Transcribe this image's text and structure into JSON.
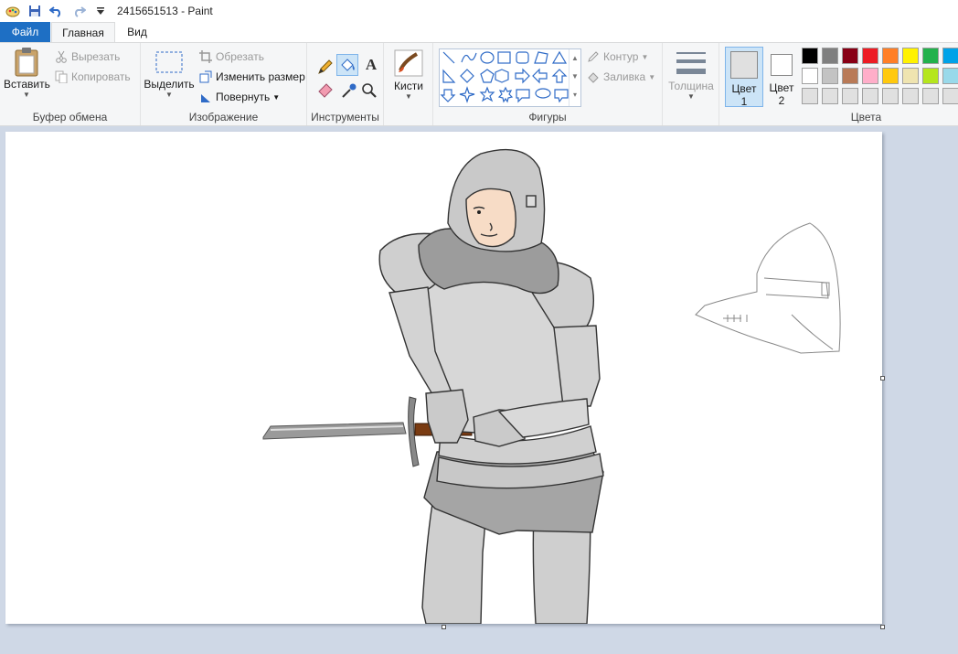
{
  "window": {
    "title": "2415651513 - Paint"
  },
  "tabs": [
    {
      "label": "Файл"
    },
    {
      "label": "Главная"
    },
    {
      "label": "Вид"
    }
  ],
  "clipboard": {
    "paste_label": "Вставить",
    "cut_label": "Вырезать",
    "copy_label": "Копировать",
    "group_label": "Буфер обмена"
  },
  "image": {
    "select_label": "Выделить",
    "crop_label": "Обрезать",
    "resize_label": "Изменить размер",
    "rotate_label": "Повернуть",
    "group_label": "Изображение"
  },
  "tools": {
    "group_label": "Инструменты",
    "text_tool_glyph": "A"
  },
  "brushes": {
    "label": "Кисти"
  },
  "shapes": {
    "outline_label": "Контур",
    "fill_label": "Заливка",
    "group_label": "Фигуры"
  },
  "size": {
    "label": "Толщина"
  },
  "colors": {
    "color1_label": "Цвет",
    "color1_num": "1",
    "color2_label": "Цвет",
    "color2_num": "2",
    "group_label": "Цвета",
    "color1_value": "#e0e0e0",
    "color2_value": "#ffffff",
    "palette_row1": [
      "#000000",
      "#7f7f7f",
      "#880015",
      "#ed1c24",
      "#ff7f27",
      "#fff200",
      "#22b14c",
      "#00a2e8"
    ],
    "palette_row2": [
      "#ffffff",
      "#c3c3c3",
      "#b97a57",
      "#ffaec9",
      "#ffc90e",
      "#efe4b0",
      "#b5e61d",
      "#99d9ea"
    ],
    "palette_row3": [
      "#e0e0e0",
      "#e0e0e0",
      "#e0e0e0",
      "#e0e0e0",
      "#e0e0e0",
      "#e0e0e0",
      "#e0e0e0",
      "#e0e0e0"
    ]
  },
  "accent": {
    "file_tab": "#1e6fc4",
    "selected_tool": "#cce4f7"
  }
}
